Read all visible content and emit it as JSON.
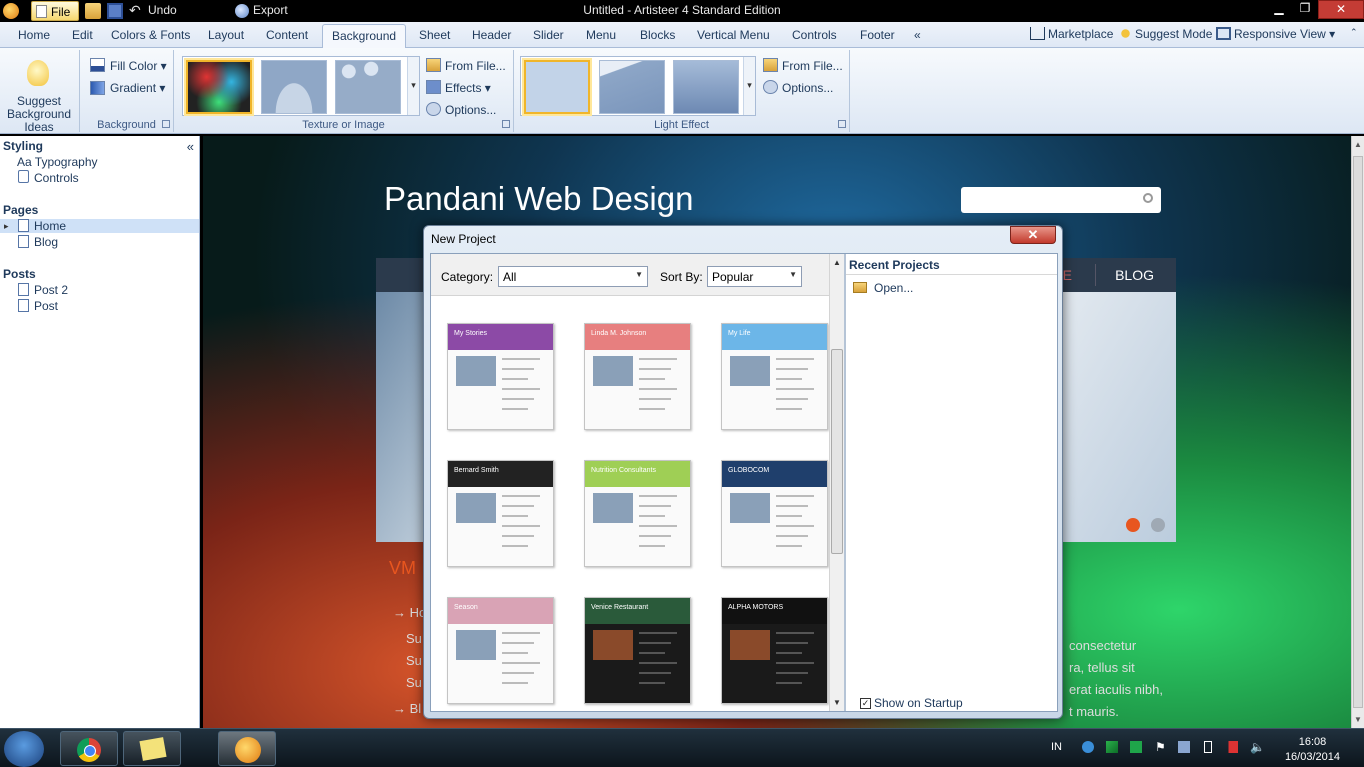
{
  "window": {
    "title": "Untitled - Artisteer 4 Standard Edition"
  },
  "quick_access": {
    "file": "File",
    "undo": "Undo",
    "export": "Export"
  },
  "ribbon_tabs": [
    "Home",
    "Edit",
    "Colors & Fonts",
    "Layout",
    "Content",
    "Background",
    "Sheet",
    "Header",
    "Slider",
    "Menu",
    "Blocks",
    "Vertical Menu",
    "Controls",
    "Footer",
    "«"
  ],
  "ribbon_active_tab": "Background",
  "ribbon_right": {
    "marketplace": "Marketplace",
    "suggest_mode": "Suggest Mode",
    "responsive_view": "Responsive View"
  },
  "ribbon": {
    "suggest_label": "Suggest Background Ideas",
    "fill_color": "Fill Color",
    "gradient": "Gradient",
    "background_group": "Background",
    "from_file": "From File...",
    "effects": "Effects",
    "options": "Options...",
    "texture_group": "Texture or Image",
    "light_from_file": "From File...",
    "light_options": "Options...",
    "light_group": "Light Effect"
  },
  "left_panel": {
    "styling_header": "Styling",
    "typography": "Aa Typography",
    "controls": "Controls",
    "pages_header": "Pages",
    "home": "Home",
    "blog": "Blog",
    "posts_header": "Posts",
    "post2": "Post 2",
    "post": "Post",
    "collapse": "«"
  },
  "site": {
    "title": "Pandani Web Design",
    "nav_blog": "BLOG",
    "nav_partial": "E",
    "heading_partial": "VM",
    "links": [
      "→ Ho",
      "Su",
      "Su",
      "Su",
      "→ Bl"
    ],
    "right_lines": [
      "consectetur",
      "ra, tellus sit",
      "erat iaculis nibh,",
      "t mauris."
    ]
  },
  "dialog": {
    "title": "New Project",
    "category_label": "Category:",
    "category_value": "All",
    "sort_label": "Sort By:",
    "sort_value": "Popular",
    "recent_header": "Recent Projects",
    "open_label": "Open...",
    "show_on_startup": "Show on Startup",
    "show_on_startup_checked": true,
    "templates": [
      {
        "title": "My Stories",
        "header_color": "#8c4aa6"
      },
      {
        "title": "Linda M. Johnson",
        "header_color": "#e77f7f"
      },
      {
        "title": "My Life",
        "header_color": "#6cb6e8"
      },
      {
        "title": "Bernard Smith",
        "header_color": "#222222"
      },
      {
        "title": "Nutrition Consultants",
        "header_color": "#9fcf55"
      },
      {
        "title": "GLOBOCOM",
        "header_color": "#1f3f6c"
      },
      {
        "title": "Season",
        "header_color": "#d9a3b5"
      },
      {
        "title": "Venice Restaurant",
        "header_color": "#2a5a3a"
      },
      {
        "title": "ALPHA MOTORS",
        "header_color": "#111111"
      }
    ]
  },
  "taskbar": {
    "lang": "IN",
    "time": "16:08",
    "date": "16/03/2014"
  }
}
